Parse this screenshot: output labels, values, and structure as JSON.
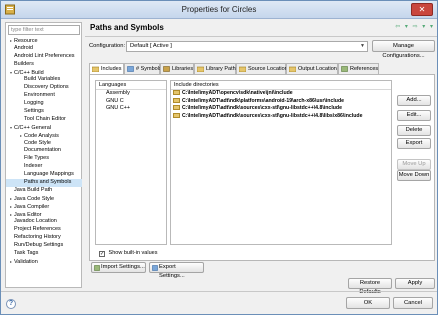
{
  "window": {
    "title": "Properties for Circles",
    "close_glyph": "✕"
  },
  "sidebar": {
    "filter_placeholder": "type filter text",
    "items": [
      {
        "label": "Resource",
        "expander": "▸"
      },
      {
        "label": "Android",
        "expander": ""
      },
      {
        "label": "Android Lint Preferences",
        "expander": ""
      },
      {
        "label": "Builders",
        "expander": ""
      },
      {
        "label": "C/C++ Build",
        "expander": "▾"
      },
      {
        "label": "Build Variables",
        "expander": ""
      },
      {
        "label": "Discovery Options",
        "expander": ""
      },
      {
        "label": "Environment",
        "expander": ""
      },
      {
        "label": "Logging",
        "expander": ""
      },
      {
        "label": "Settings",
        "expander": ""
      },
      {
        "label": "Tool Chain Editor",
        "expander": ""
      },
      {
        "label": "C/C++ General",
        "expander": "▾"
      },
      {
        "label": "Code Analysis",
        "expander": "▸"
      },
      {
        "label": "Code Style",
        "expander": ""
      },
      {
        "label": "Documentation",
        "expander": ""
      },
      {
        "label": "File Types",
        "expander": ""
      },
      {
        "label": "Indexer",
        "expander": ""
      },
      {
        "label": "Language Mappings",
        "expander": ""
      },
      {
        "label": "Paths and Symbols",
        "expander": ""
      },
      {
        "label": "Java Build Path",
        "expander": ""
      },
      {
        "label": "Java Code Style",
        "expander": "▸"
      },
      {
        "label": "Java Compiler",
        "expander": "▸"
      },
      {
        "label": "Java Editor",
        "expander": "▸"
      },
      {
        "label": "Javadoc Location",
        "expander": ""
      },
      {
        "label": "Project References",
        "expander": ""
      },
      {
        "label": "Refactoring History",
        "expander": ""
      },
      {
        "label": "Run/Debug Settings",
        "expander": ""
      },
      {
        "label": "Task Tags",
        "expander": ""
      },
      {
        "label": "Validation",
        "expander": "▸"
      }
    ],
    "selected_index": 18
  },
  "header": {
    "title": "Paths and Symbols",
    "nav": [
      "⇦",
      "▾",
      "⇨",
      "▾",
      "▾"
    ]
  },
  "configuration": {
    "label": "Configuration:",
    "value": "Default  [ Active ]",
    "manage_button": "Manage Configurations..."
  },
  "tabs": [
    "Includes",
    "# Symbols",
    "Libraries",
    "Library Paths",
    "Source Location",
    "Output Location",
    "References"
  ],
  "active_tab": 0,
  "languages": {
    "header": "Languages",
    "items": [
      "Assembly",
      "GNU C",
      "GNU C++"
    ]
  },
  "includes": {
    "header": "Include directories",
    "items": [
      "C:\\Intel\\myADT\\opencv\\sdk\\native\\jni\\include",
      "C:\\Intel\\myADT\\adt\\ndk\\platforms\\android-19\\arch-x86\\usr\\include",
      "C:\\Intel\\myADT\\adt\\ndk\\sources\\cxx-stl\\gnu-libstdc++\\4.8\\include",
      "C:\\Intel\\myADT\\adt\\ndk\\sources\\cxx-stl\\gnu-libstdc++\\4.8\\libs\\x86\\include"
    ]
  },
  "side_buttons": {
    "add": "Add...",
    "edit": "Edit...",
    "delete": "Delete",
    "export": "Export",
    "move_up": "Move Up",
    "move_down": "Move Down"
  },
  "show_builtin": {
    "label": "Show built-in values",
    "checked": true,
    "check_glyph": "✓"
  },
  "import_button": "Import Settings...",
  "export_button": "Export Settings...",
  "restore_defaults": "Restore Defaults",
  "apply": "Apply",
  "ok": "OK",
  "cancel": "Cancel",
  "help_glyph": "?"
}
